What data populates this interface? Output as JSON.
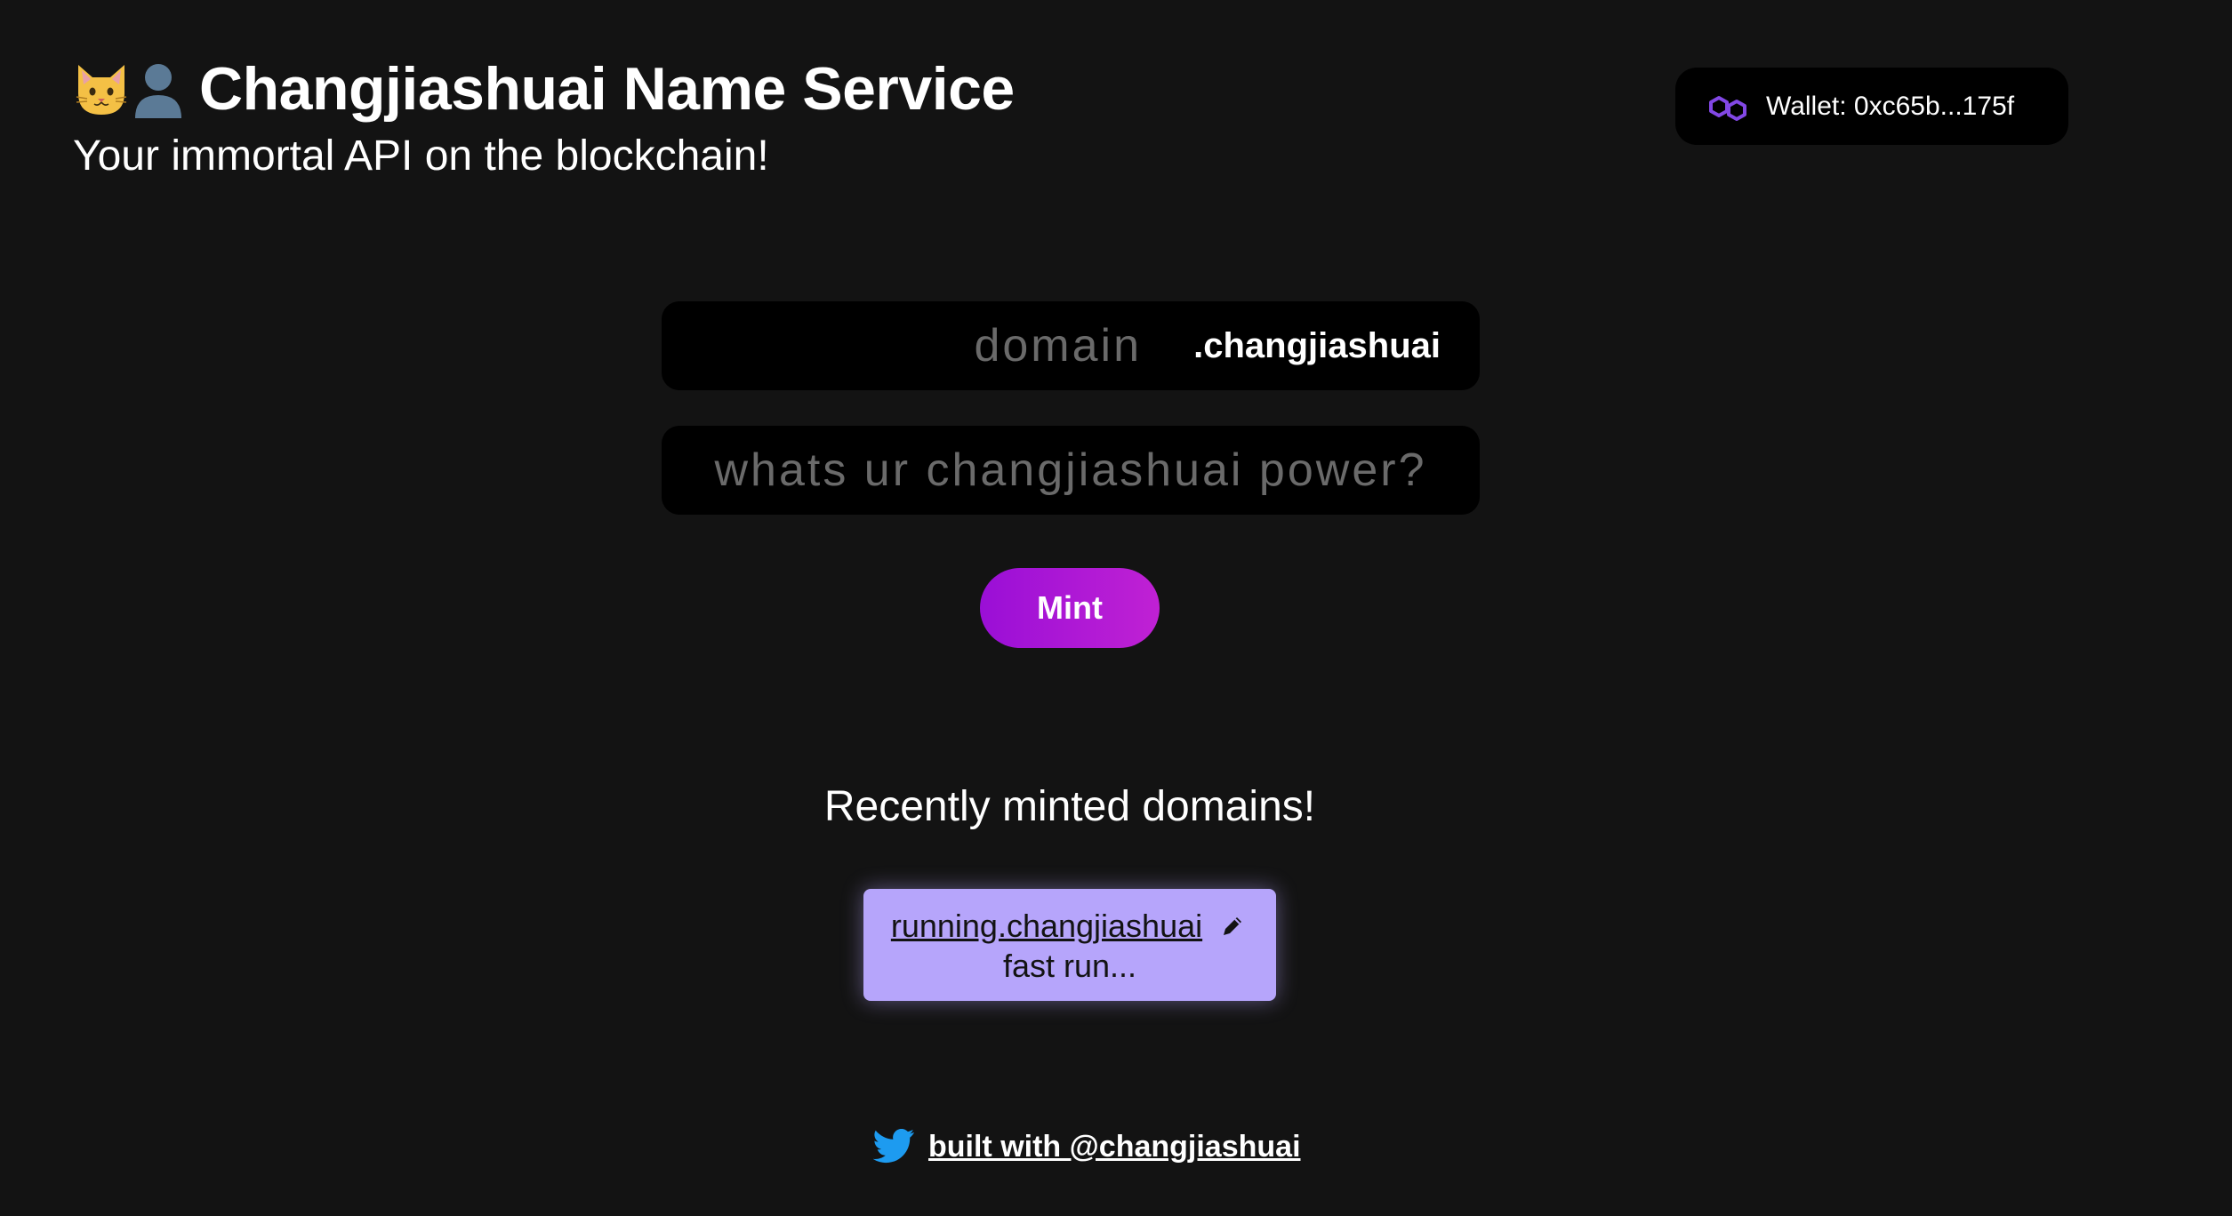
{
  "header": {
    "title": "Changjiashuai Name Service",
    "subtitle": "Your immortal API on the blockchain!",
    "emoji_icons": [
      "cat-face-icon",
      "person-silhouette-icon"
    ]
  },
  "wallet": {
    "label": "Wallet: 0xc65b...175f",
    "icon": "polygon-icon",
    "icon_color": "#8247e5"
  },
  "form": {
    "domain_placeholder": "domain",
    "domain_value": "",
    "tld": ".changjiashuai",
    "record_placeholder": "whats ur changjiashuai power?",
    "record_value": "",
    "mint_label": "Mint"
  },
  "recent": {
    "heading": "Recently minted domains!",
    "items": [
      {
        "domain": "running.changjiashuai",
        "record": "fast run...",
        "icon": "pencil-icon"
      }
    ]
  },
  "footer": {
    "link_text": "built with @changjiashuai",
    "icon": "twitter-icon"
  },
  "colors": {
    "background": "#131313",
    "accent_start": "#9a0fd6",
    "accent_end": "#c021d4",
    "card": "#b6a5fb",
    "twitter": "#1d9bf0"
  }
}
